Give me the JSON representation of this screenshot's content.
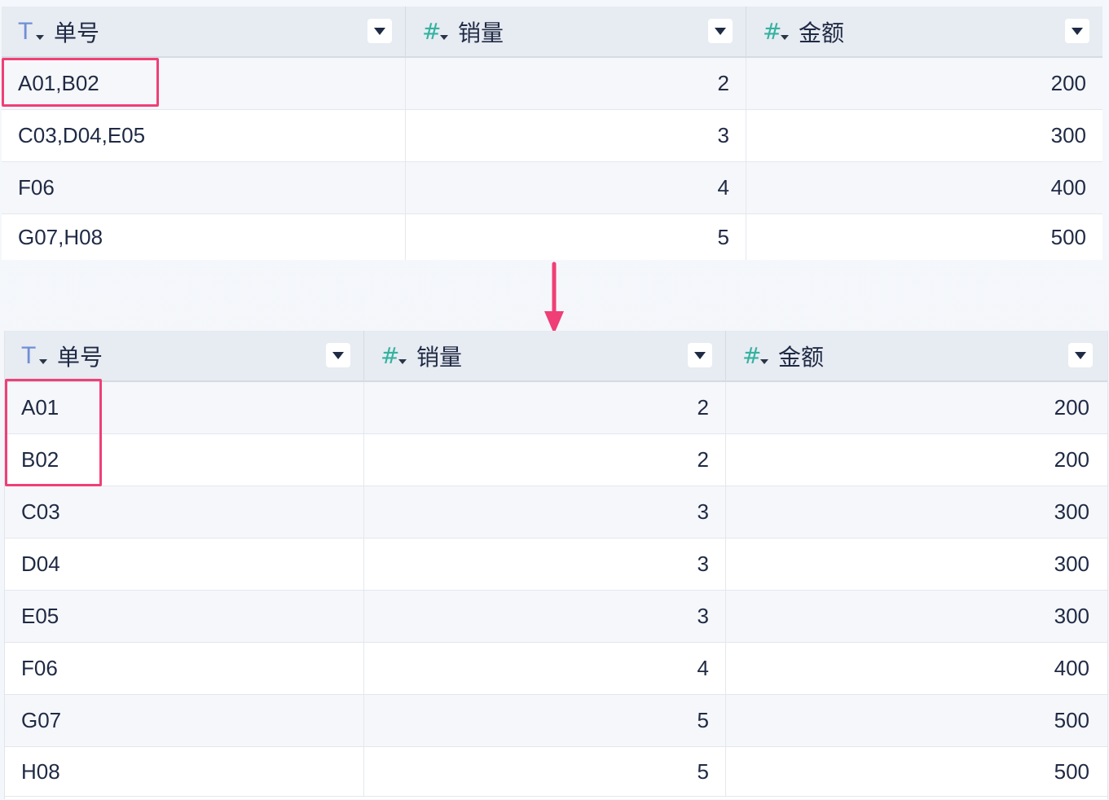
{
  "columns": [
    {
      "type": "text",
      "icon": "text-type-icon",
      "label": "单号"
    },
    {
      "type": "number",
      "icon": "number-type-icon",
      "label": "销量"
    },
    {
      "type": "number",
      "icon": "number-type-icon",
      "label": "金额"
    }
  ],
  "colors": {
    "accent_highlight": "#ef3f76",
    "text_type": "#6f8fd6",
    "number_type": "#34b3a0"
  },
  "before_table": {
    "rows": [
      [
        "A01,B02",
        "2",
        "200"
      ],
      [
        "C03,D04,E05",
        "3",
        "300"
      ],
      [
        "F06",
        "4",
        "400"
      ],
      [
        "G07,H08",
        "5",
        "500"
      ]
    ]
  },
  "after_table": {
    "rows": [
      [
        "A01",
        "2",
        "200"
      ],
      [
        "B02",
        "2",
        "200"
      ],
      [
        "C03",
        "3",
        "300"
      ],
      [
        "D04",
        "3",
        "300"
      ],
      [
        "E05",
        "3",
        "300"
      ],
      [
        "F06",
        "4",
        "400"
      ],
      [
        "G07",
        "5",
        "500"
      ],
      [
        "H08",
        "5",
        "500"
      ]
    ]
  }
}
